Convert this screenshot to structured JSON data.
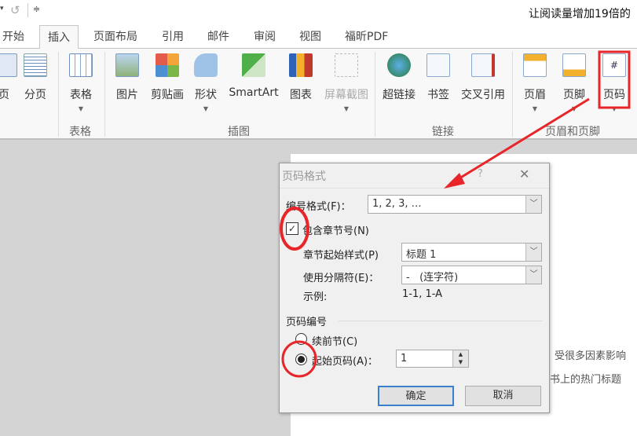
{
  "title_bar": {
    "doc_title": "让阅读量增加19倍的",
    "undo_icon": "undo-icon",
    "customize_icon": "customize-qat-icon"
  },
  "tabs": [
    "开始",
    "插入",
    "页面布局",
    "引用",
    "邮件",
    "审阅",
    "视图",
    "福昕PDF"
  ],
  "active_tab": "插入",
  "ribbon": {
    "groups": [
      {
        "label": "",
        "buttons": [
          "页",
          "分页"
        ]
      },
      {
        "label": "表格",
        "buttons": [
          "表格"
        ]
      },
      {
        "label": "插图",
        "buttons": [
          "图片",
          "剪贴画",
          "形状",
          "SmartArt",
          "图表",
          "屏幕截图"
        ]
      },
      {
        "label": "链接",
        "buttons": [
          "超链接",
          "书签",
          "交叉引用"
        ]
      },
      {
        "label": "页眉和页脚",
        "buttons": [
          "页眉",
          "页脚",
          "页码"
        ]
      }
    ]
  },
  "document": {
    "lines": [
      "受很多因素影响",
      "书上的热门标题"
    ]
  },
  "dialog": {
    "title": "页码格式",
    "help": "?",
    "close": "✕",
    "number_format_label": "编号格式(F)：",
    "number_format_value": "1, 2, 3, …",
    "include_chapter_label": "包含章节号(N)",
    "include_chapter_checked": true,
    "chapter_style_label": "章节起始样式(P)",
    "chapter_style_value": "标题 1",
    "separator_label": "使用分隔符(E)：",
    "separator_value": "-   (连字符)",
    "example_label": "示例:",
    "example_value": "1-1, 1-A",
    "numbering_section": "页码编号",
    "continue_label": "续前节(C)",
    "start_at_label": "起始页码(A)：",
    "start_at_value": "1",
    "selected_option": "start_at",
    "ok": "确定",
    "cancel": "取消"
  },
  "annotation_color": "#e8262a"
}
